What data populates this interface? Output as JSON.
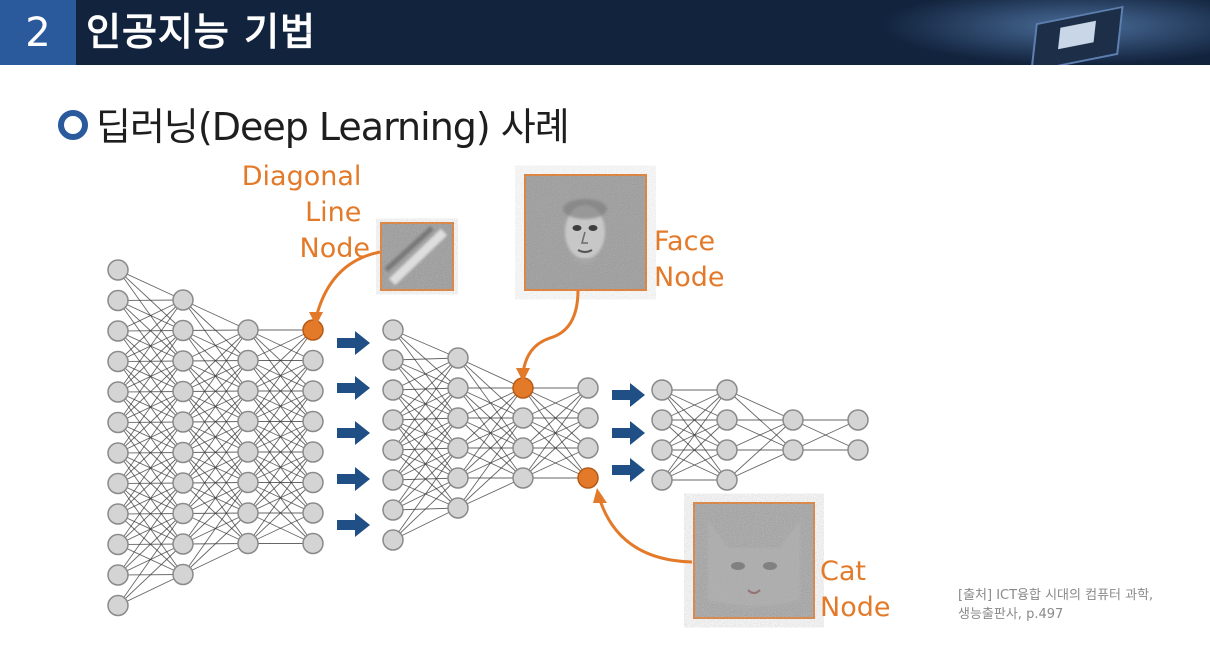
{
  "header": {
    "section_number": "2",
    "title": "인공지능 기법"
  },
  "subtitle": "딥러닝(Deep Learning) 사례",
  "labels": {
    "diagonal": [
      "Diagonal",
      "Line",
      "Node"
    ],
    "face": [
      "Face",
      "Node"
    ],
    "cat": [
      "Cat",
      "Node"
    ]
  },
  "caption": {
    "line1": "[출처] ICT융합 시대의 컴퓨터 과학,",
    "line2": "생능출판사, p.497"
  },
  "colors": {
    "accent_blue": "#2a5a9c",
    "header_bg": "#12233d",
    "highlight_orange": "#e37a2a",
    "node_gray": "#d4d4d4",
    "arrow_blue": "#1f4f84"
  },
  "icons": [
    "circle-bullet-icon",
    "right-arrow-icon",
    "microchip-icon"
  ]
}
